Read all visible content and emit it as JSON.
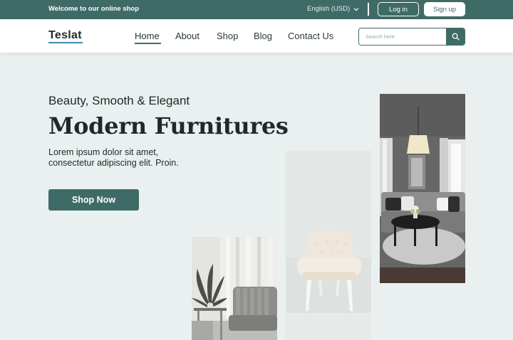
{
  "topbar": {
    "welcome": "Welcome to our online shop",
    "language": "English (USD)",
    "login_label": "Log in",
    "signup_label": "Sign up"
  },
  "nav": {
    "logo": "Teslat",
    "items": [
      {
        "label": "Home",
        "active": true
      },
      {
        "label": "About"
      },
      {
        "label": "Shop"
      },
      {
        "label": "Blog"
      },
      {
        "label": "Contact Us"
      }
    ],
    "search_placeholder": "Search here"
  },
  "hero": {
    "tagline": "Beauty, Smooth & Elegant",
    "headline": "Modern Furnitures",
    "description": "Lorem ipsum dolor sit amet, consectetur adipiscing elit. Proin.",
    "cta_label": "Shop Now"
  },
  "colors": {
    "brand": "#3f6b67",
    "page_bg": "#eaf0ef",
    "accent_underline": "#3f8ab1"
  },
  "icons": {
    "language_dropdown": "chevron-down-icon",
    "search": "search-icon"
  }
}
